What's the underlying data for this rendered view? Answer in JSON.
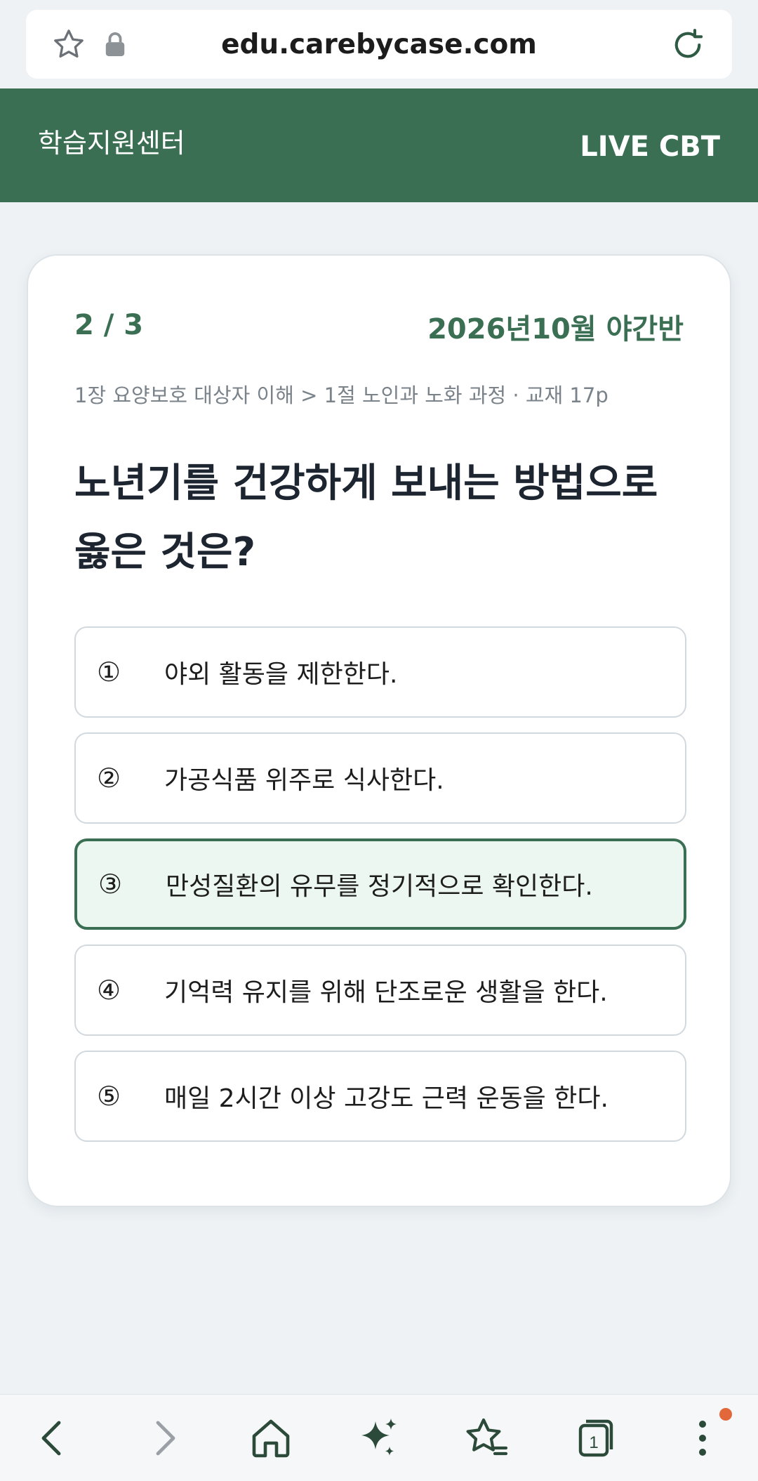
{
  "browser": {
    "url": "edu.carebycase.com"
  },
  "header": {
    "brand": "학습지원센터",
    "mode": "LIVE CBT"
  },
  "quiz": {
    "progress": "2 / 3",
    "session": "2026년10월 야간반",
    "breadcrumb": "1장 요양보호 대상자 이해 > 1절 노인과 노화 과정 · 교재 17p",
    "question_line1": "노년기를 건강하게 보내는 방법으로",
    "question_line2": "옳은 것은?",
    "options": [
      {
        "num": "①",
        "text": "야외 활동을 제한한다."
      },
      {
        "num": "②",
        "text": "가공식품 위주로 식사한다."
      },
      {
        "num": "③",
        "text": "만성질환의 유무를 정기적으로 확인한다."
      },
      {
        "num": "④",
        "text": "기억력 유지를 위해 단조로운 생활을 한다."
      },
      {
        "num": "⑤",
        "text": "매일 2시간 이상 고강도 근력 운동을 한다."
      }
    ],
    "selected_index": 2
  },
  "bottom_nav": {
    "tab_count": "1"
  },
  "colors": {
    "accent": "#3b6f53",
    "selected_bg": "#edf7f1",
    "notify": "#e2683c"
  }
}
